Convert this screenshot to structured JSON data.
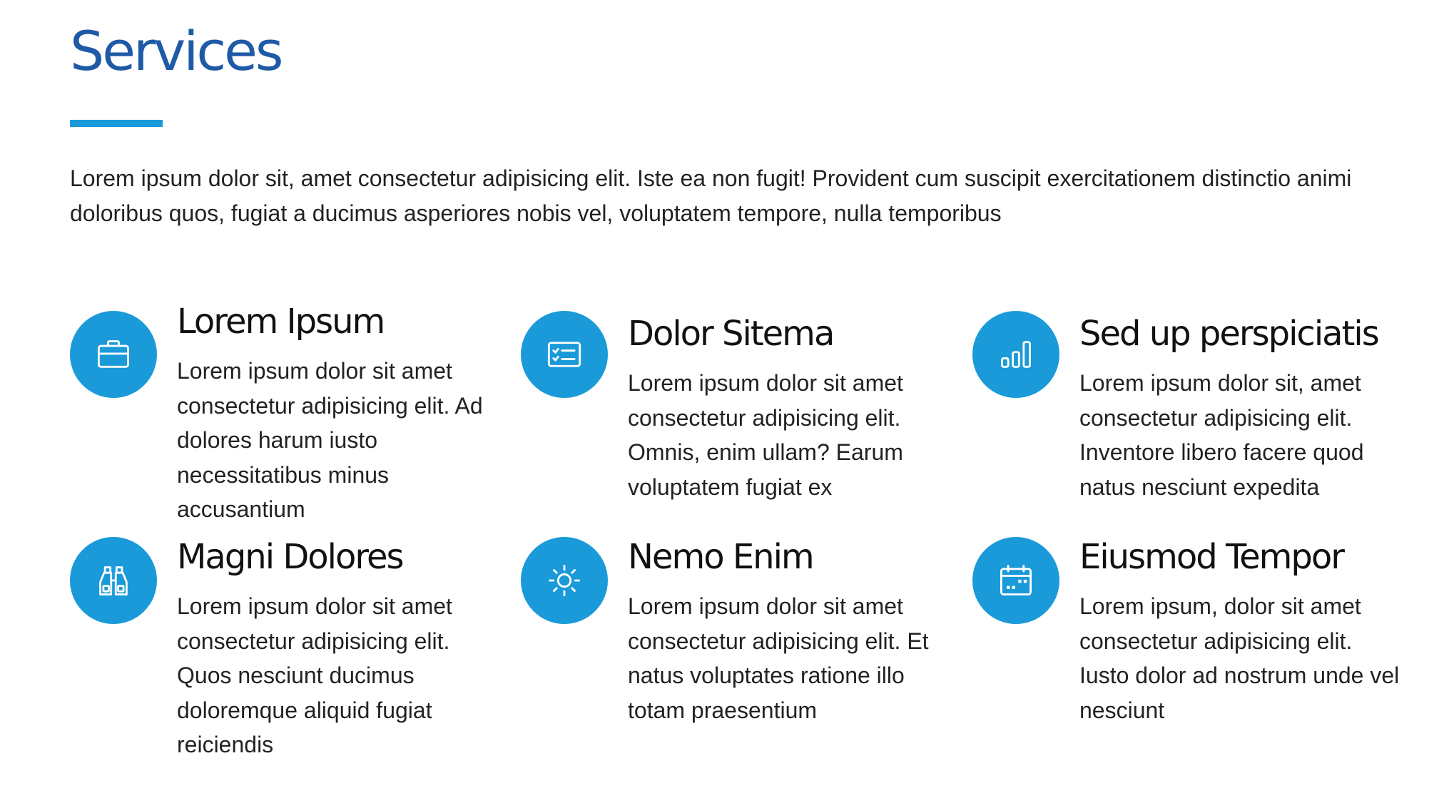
{
  "colors": {
    "title": "#1f5aa6",
    "accent": "#1a9ad9",
    "text": "#222222",
    "heading": "#111111"
  },
  "page": {
    "title": "Services",
    "intro": "Lorem ipsum dolor sit, amet consectetur adipisicing elit. Iste ea non fugit! Provident cum suscipit exercitationem distinctio animi doloribus quos, fugiat a ducimus asperiores nobis vel, voluptatem tempore, nulla temporibus"
  },
  "services": [
    {
      "icon": "briefcase-icon",
      "title": "Lorem Ipsum",
      "text": "Lorem ipsum dolor sit amet consectetur adipisicing elit. Ad dolores harum iusto necessitatibus minus accusantium"
    },
    {
      "icon": "checklist-card-icon",
      "title": "Dolor Sitema",
      "text": "Lorem ipsum dolor sit amet consectetur adipisicing elit. Omnis, enim ullam? Earum voluptatem fugiat ex"
    },
    {
      "icon": "bar-chart-icon",
      "title": "Sed up perspiciatis",
      "text": "Lorem ipsum dolor sit, amet consectetur adipisicing elit. Inventore libero facere quod natus nesciunt expedita"
    },
    {
      "icon": "binoculars-icon",
      "title": "Magni Dolores",
      "text": "Lorem ipsum dolor sit amet consectetur adipisicing elit. Quos nesciunt ducimus doloremque aliquid fugiat reiciendis"
    },
    {
      "icon": "sun-icon",
      "title": "Nemo Enim",
      "text": "Lorem ipsum dolor sit amet consectetur adipisicing elit. Et natus voluptates ratione illo totam praesentium"
    },
    {
      "icon": "calendar-icon",
      "title": "Eiusmod Tempor",
      "text": "Lorem ipsum, dolor sit amet consectetur adipisicing elit. Iusto dolor ad nostrum unde vel nesciunt"
    }
  ]
}
